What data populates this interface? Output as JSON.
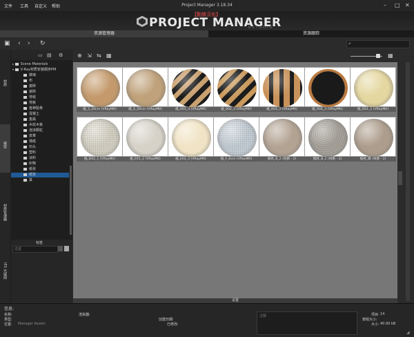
{
  "menu": [
    "文件",
    "工具",
    "自定义",
    "帮助"
  ],
  "window_title": "Project Manager 3.18.34",
  "window_controls": [
    "–",
    "□",
    "✕"
  ],
  "brand": {
    "tag": "【勤族汉化】",
    "name": "PROJECT MANAGER",
    "sub": "KSTUDIO"
  },
  "tabs": [
    "资源管理器",
    "资源跟踪"
  ],
  "left_strip": [
    "材质",
    "模型",
    "材质库",
    "材质管理器",
    "IES 光域网"
  ],
  "tree": {
    "roots": [
      "Scene Materials",
      "V-Ray材质安装顺序PM"
    ],
    "folders": [
      "玻璃",
      "布",
      "瓷砖",
      "瓷砖",
      "地毯",
      "地板",
      "各种贴骨",
      "混凝土",
      "金属",
      "木纹木板",
      "泡沫颗粒",
      "皮革",
      "墙纸",
      "石头",
      "塑料",
      "涂料",
      "织物",
      "纸张",
      "其"
    ],
    "selected_index": 17,
    "bottom_title": "标签",
    "bottom_search_placeholder": "过滤"
  },
  "tiles": [
    {
      "caption": "纸_3_20cm (VRayMtl)",
      "color": "#c49a6c",
      "pattern": "plain"
    },
    {
      "caption": "纸_4_20cm (VRayMtl)",
      "color": "#bfa17a",
      "pattern": "plain"
    },
    {
      "caption": "纸_001_3 (VRayMtl)",
      "color": "#c9a070",
      "pattern": "chevron"
    },
    {
      "caption": "纸_002_3 (VRayMtl)",
      "color": "#c99a5d",
      "pattern": "chevron"
    },
    {
      "caption": "纸_003_3 (VRayMtl)",
      "color": "#c8925a",
      "pattern": "stripes"
    },
    {
      "caption": "纸_004_3 (VRayMtl)",
      "color": "#b87a42",
      "pattern": "ring"
    },
    {
      "caption": "纸_DS1_1 (VRayMtl)",
      "color": "#e5d7a0",
      "pattern": "plain"
    },
    {
      "caption": "纸_D02_1 (VRayMtl)",
      "color": "#d7d4c6",
      "pattern": "grid"
    },
    {
      "caption": "纸_E01_2 (VRayMtl)",
      "color": "#d6d2c8",
      "pattern": "plain"
    },
    {
      "caption": "纸_E02_3 (VRayMtl)",
      "color": "#f1e4c6",
      "pattern": "plain"
    },
    {
      "caption": "纸_F_6cm (VRayMtl)",
      "color": "#c7d0d8",
      "pattern": "grid"
    },
    {
      "caption": "纸纹_B_2 (材质 - 2)",
      "color": "#b3a393",
      "pattern": "plain"
    },
    {
      "caption": "纸纹_B_2 (材质 - 2)",
      "color": "#a8a49c",
      "pattern": "speckle"
    },
    {
      "caption": "纸纹_麻 (材质 - 2)",
      "color": "#ad9d8c",
      "pattern": "plain"
    }
  ],
  "settings_label": "设置",
  "info": {
    "title": "信息:",
    "labels": [
      "名称:",
      "类型:",
      "位置:"
    ],
    "location_value": "Manager Assets",
    "renderer_label": "渲染器:",
    "created_label": "创建日期:",
    "modified_label": "已修改:",
    "comment_placeholder": "注释",
    "stats_labels": [
      "项目:",
      "按组大小:",
      "大小:"
    ],
    "stats_values": [
      "14",
      "",
      "40.00 kB"
    ]
  },
  "search_placeholder": "",
  "colors": {
    "accent": "#1f5a96",
    "brand_tag": "#ff5050",
    "content_bg": "#777777"
  }
}
